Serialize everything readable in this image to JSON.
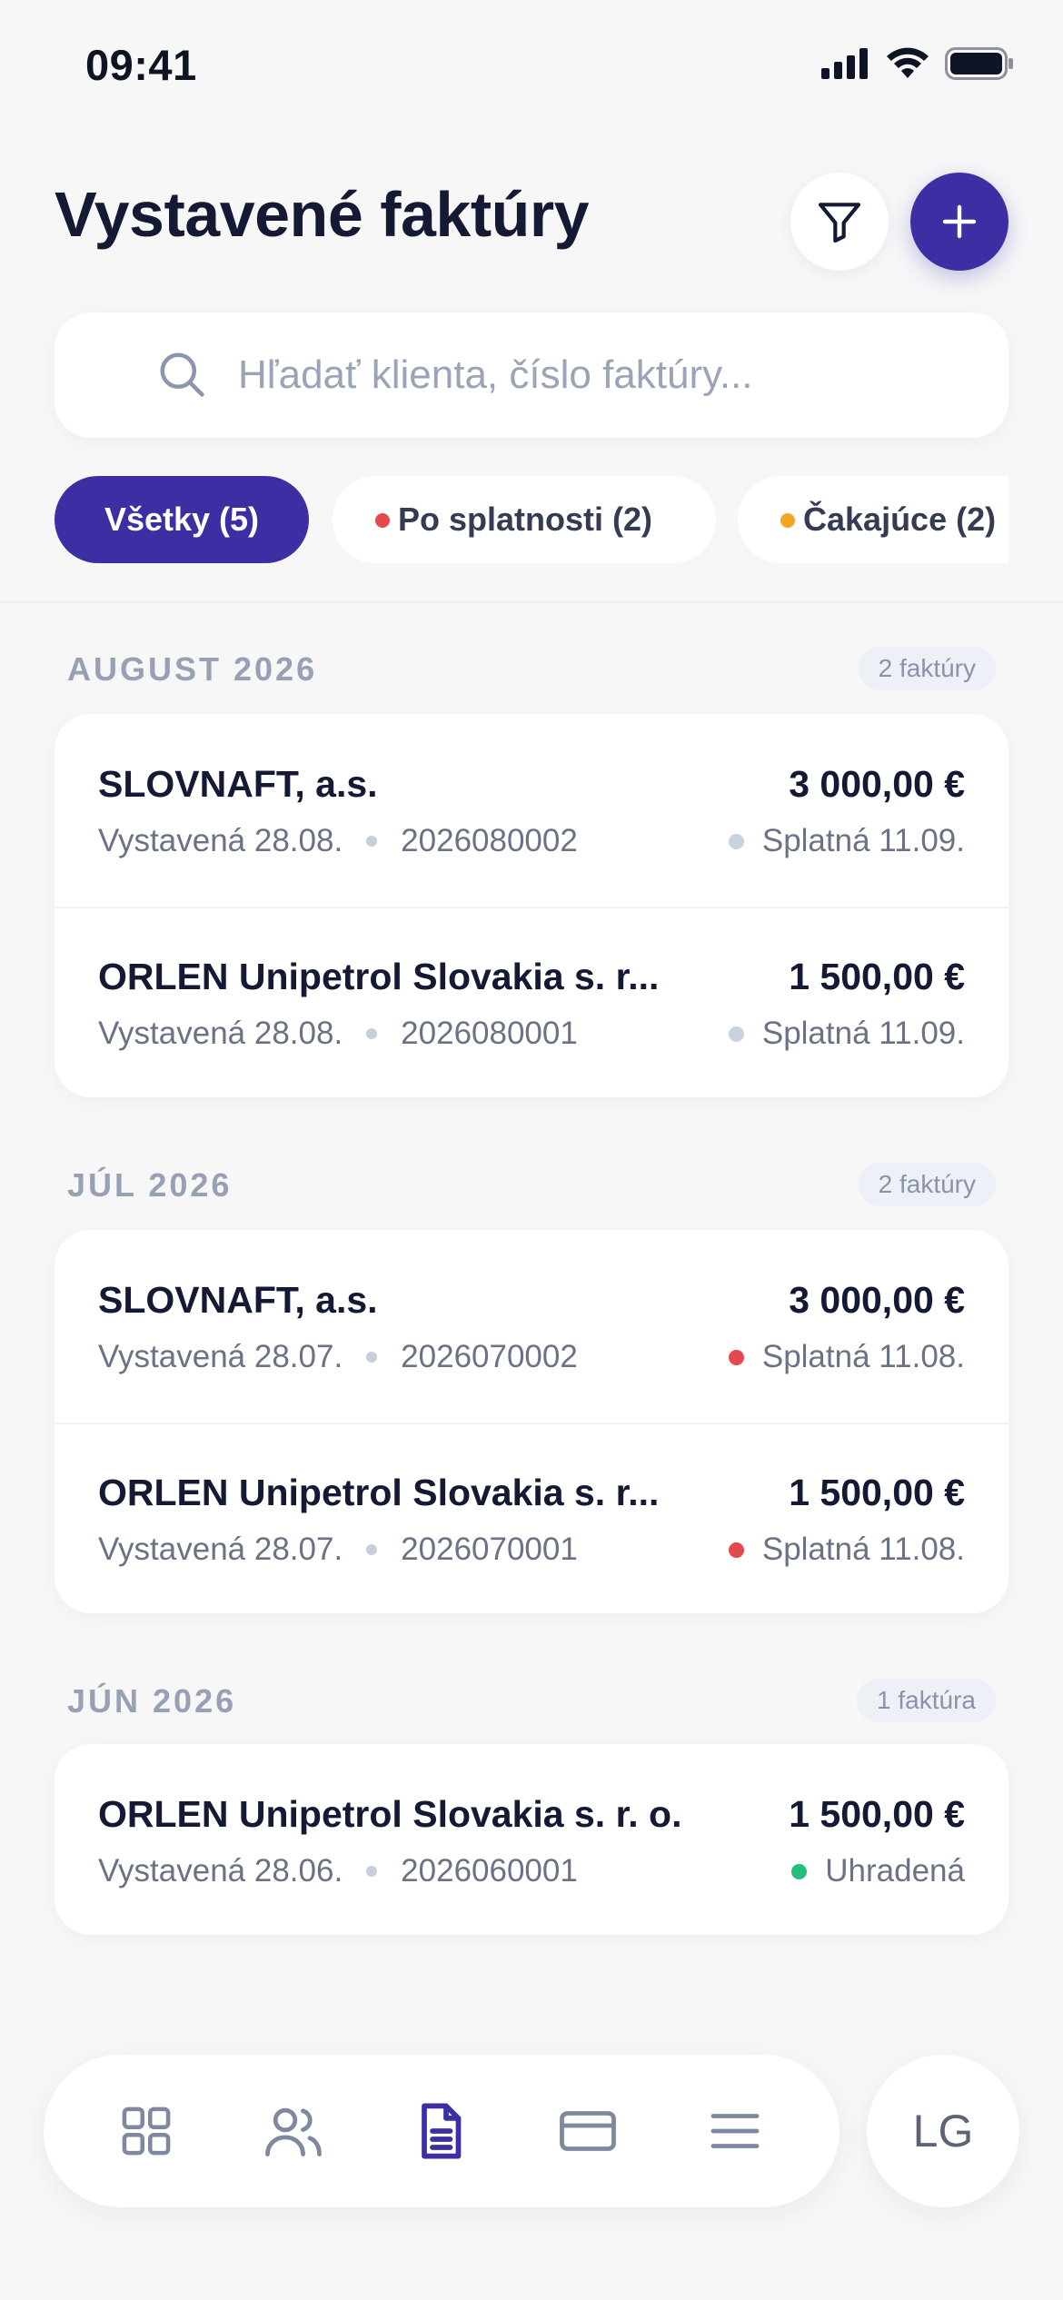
{
  "status_bar": {
    "time": "09:41"
  },
  "header": {
    "title": "Vystavené faktúry"
  },
  "search": {
    "placeholder": "Hľadať klienta, číslo faktúry...",
    "value": ""
  },
  "filters": [
    {
      "label": "Všetky (5)",
      "active": true
    },
    {
      "label": "Po splatnosti (2)",
      "dot_color": "#e5484d"
    },
    {
      "label": "Čakajúce (2)",
      "dot_color": "#f5a524"
    }
  ],
  "sections": [
    {
      "label": "AUGUST 2026",
      "count": "2 faktúry",
      "invoices": [
        {
          "client": "SLOVNAFT, a.s.",
          "amount": "3 000,00 €",
          "issued": "Vystavená 28.08.",
          "number": "2026080002",
          "due": "Splatná 11.09.",
          "status_color": "#c8d3e2"
        },
        {
          "client": "ORLEN Unipetrol Slovakia s. r...",
          "amount": "1 500,00 €",
          "issued": "Vystavená 28.08.",
          "number": "2026080001",
          "due": "Splatná 11.09.",
          "status_color": "#c8d3e2"
        }
      ]
    },
    {
      "label": "JÚL 2026",
      "count": "2 faktúry",
      "invoices": [
        {
          "client": "SLOVNAFT, a.s.",
          "amount": "3 000,00 €",
          "issued": "Vystavená 28.07.",
          "number": "2026070002",
          "due": "Splatná 11.08.",
          "status_color": "#e5484d"
        },
        {
          "client": "ORLEN Unipetrol Slovakia s. r...",
          "amount": "1 500,00 €",
          "issued": "Vystavená 28.07.",
          "number": "2026070001",
          "due": "Splatná 11.08.",
          "status_color": "#e5484d"
        }
      ]
    },
    {
      "label": "JÚN 2026",
      "count": "1 faktúra",
      "invoices": [
        {
          "client": "ORLEN Unipetrol Slovakia s. r. o.",
          "amount": "1 500,00 €",
          "issued": "Vystavená 28.06.",
          "number": "2026060001",
          "due": "Uhradená",
          "status_color": "#22c07a"
        }
      ]
    }
  ],
  "tabbar": {
    "tabs": [
      {
        "icon": "dashboard-grid-icon"
      },
      {
        "icon": "clients-icon"
      },
      {
        "icon": "invoice-document-icon",
        "active": true
      },
      {
        "icon": "card-icon"
      },
      {
        "icon": "menu-icon"
      }
    ],
    "avatar_initials": "LG"
  },
  "colors": {
    "accent": "#3b2fa3",
    "overdue": "#e5484d",
    "pending": "#f5a524",
    "paid": "#22c07a"
  }
}
